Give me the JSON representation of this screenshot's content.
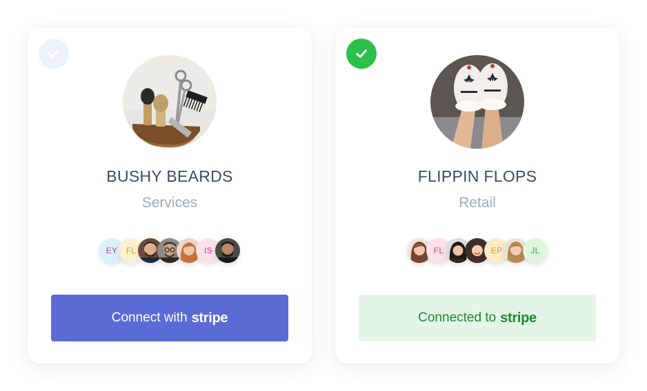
{
  "cards": [
    {
      "business_name": "BUSHY BEARDS",
      "category": "Services",
      "selected": false,
      "photo": "barber-tools-photo",
      "button": {
        "prefix": "Connect with",
        "brand": "stripe",
        "state": "connect"
      },
      "team": [
        {
          "initials": "EY",
          "bg": "#d9f1fb",
          "fg": "#c13e86"
        },
        {
          "initials": "FL",
          "bg": "#fdf0cf",
          "fg": "#d4a020"
        },
        {
          "initials": "",
          "photo": "man-beard-avatar"
        },
        {
          "initials": "",
          "photo": "man-glasses-avatar"
        },
        {
          "initials": "",
          "photo": "woman-red-hair-avatar"
        },
        {
          "initials": "IS",
          "bg": "#fde0ea",
          "fg": "#d0447e"
        },
        {
          "initials": "",
          "photo": "man-dark-avatar"
        }
      ]
    },
    {
      "business_name": "FLIPPIN FLOPS",
      "category": "Retail",
      "selected": true,
      "photo": "slippers-photo",
      "button": {
        "prefix": "Connected to",
        "brand": "stripe",
        "state": "connected"
      },
      "team": [
        {
          "initials": "",
          "photo": "woman-brown-hair-avatar"
        },
        {
          "initials": "FL",
          "bg": "#fde0ea",
          "fg": "#d0447e"
        },
        {
          "initials": "",
          "photo": "woman-dark-hair-avatar"
        },
        {
          "initials": "",
          "photo": "woman-smiling-avatar"
        },
        {
          "initials": "EP",
          "bg": "#fdebc9",
          "fg": "#d79b22"
        },
        {
          "initials": "",
          "photo": "woman-blonde-avatar"
        },
        {
          "initials": "JL",
          "bg": "#dff6dd",
          "fg": "#3fa34a"
        }
      ]
    }
  ],
  "colors": {
    "connect_button": "#5a6bd6",
    "connected_button_bg": "#e4f5e8",
    "connected_text": "#1c8a2c",
    "check_selected": "#2bc04a",
    "check_unselected": "#eef0fc",
    "title_text": "#3c4a66",
    "category_text": "#a3a8b3"
  }
}
